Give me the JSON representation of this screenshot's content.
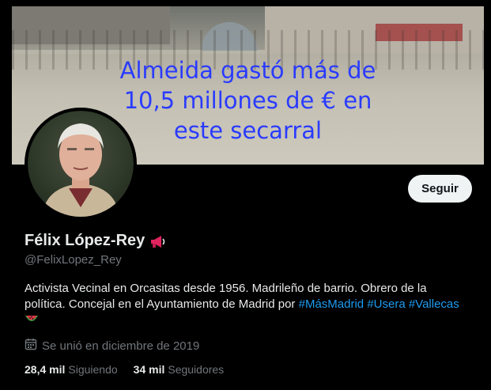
{
  "banner": {
    "line1": "Almeida gastó más de",
    "line2": "10,5 millones de € en",
    "line3": "este secarral"
  },
  "profile": {
    "display_name": "Félix López-Rey",
    "handle": "@FelixLopez_Rey",
    "follow_label": "Seguir",
    "bio": {
      "text1": "Activista Vecinal en Orcasitas desde 1956. Madrileño de barrio. Obrero de la política. Concejal en el Ayuntamiento de Madrid por ",
      "tag1": "#MásMadrid",
      "tag2": "#Usera",
      "tag3": "#Vallecas"
    },
    "joined": "Se unió en diciembre de 2019",
    "following_count": "28,4 mil",
    "following_label": "Siguiendo",
    "followers_count": "34 mil",
    "followers_label": "Seguidores"
  },
  "icons": {
    "name_emoji": "megaphone-icon",
    "bio_emoji": "watermelon-icon",
    "joined": "calendar-icon"
  },
  "colors": {
    "accent": "#1d9bf0",
    "text": "#e7e9ea",
    "muted": "#71767b",
    "background": "#000000",
    "banner_text": "#2a3bff"
  }
}
